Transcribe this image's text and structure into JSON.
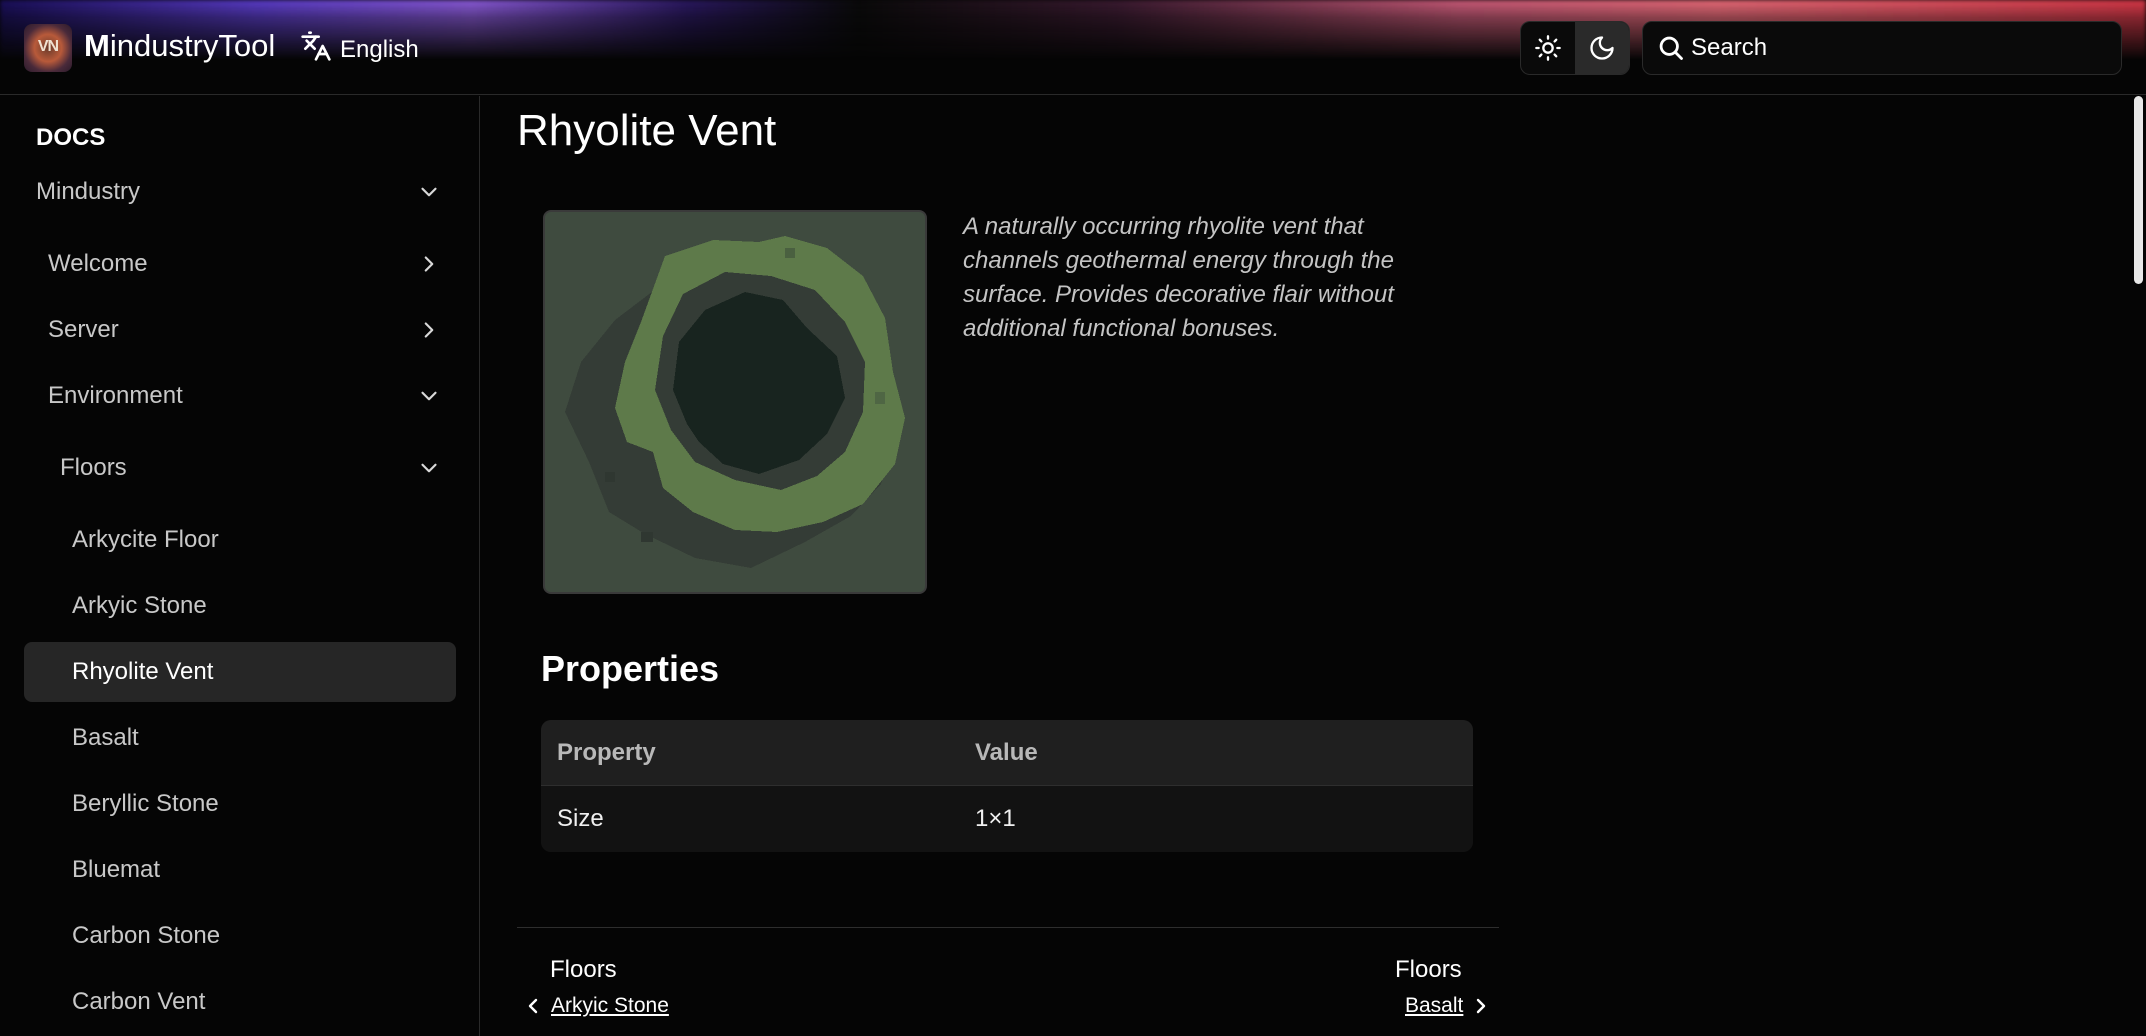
{
  "header": {
    "logo_text": "VN",
    "brand_first": "M",
    "brand_rest": "industryTool",
    "language": "English",
    "search_placeholder": "Search"
  },
  "sidebar": {
    "section_label": "DOCS",
    "groups": [
      {
        "label": "Mindustry",
        "state": "expanded"
      },
      {
        "label": "Welcome",
        "state": "collapsed"
      },
      {
        "label": "Server",
        "state": "collapsed"
      },
      {
        "label": "Environment",
        "state": "expanded"
      },
      {
        "label": "Floors",
        "state": "expanded"
      }
    ],
    "items": [
      {
        "label": "Arkycite Floor"
      },
      {
        "label": "Arkyic Stone"
      },
      {
        "label": "Rhyolite Vent",
        "active": true
      },
      {
        "label": "Basalt"
      },
      {
        "label": "Beryllic Stone"
      },
      {
        "label": "Bluemat"
      },
      {
        "label": "Carbon Stone"
      },
      {
        "label": "Carbon Vent"
      }
    ]
  },
  "main": {
    "title": "Rhyolite Vent",
    "description": "A naturally occurring rhyolite vent that channels geothermal energy through the surface. Provides decorative flair without additional functional bonuses.",
    "properties_title": "Properties",
    "table": {
      "headers": [
        "Property",
        "Value"
      ],
      "rows": [
        [
          "Size",
          "1×1"
        ]
      ]
    },
    "pager": {
      "prev_section": "Floors",
      "prev_link": "Arkyic Stone",
      "next_section": "Floors",
      "next_link": "Basalt"
    }
  },
  "colors": {
    "background": "#050505",
    "active_item": "#262626",
    "vent_outer": "#3f4b3f",
    "vent_rim_light": "#5e7a4a",
    "vent_rim_dark": "#343c36",
    "vent_core": "#18241f"
  }
}
